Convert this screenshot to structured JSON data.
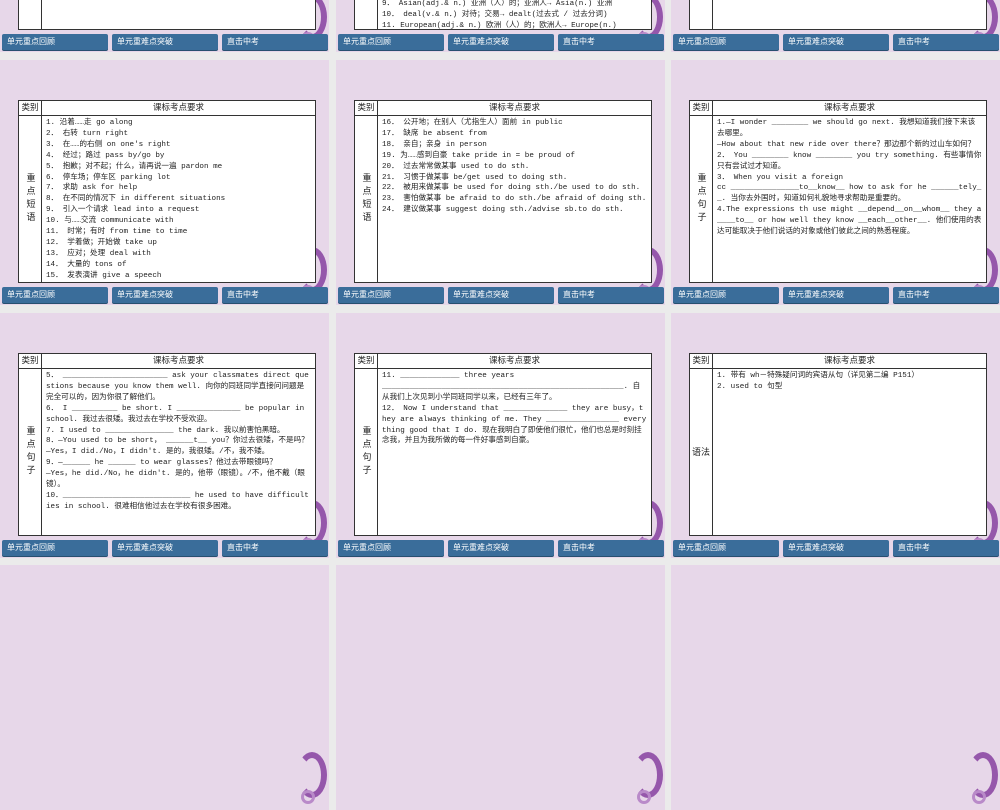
{
  "nav": [
    "单元重点回顾",
    "单元重难点突破",
    "直击中考"
  ],
  "table_header": {
    "category": "类别",
    "requirement": "课标考点要求"
  },
  "colors": {
    "slide_bg": "#e7d7e9",
    "nav_bg": "#3a6d9a",
    "decor": "#8d4aa5"
  },
  "slides": [
    {
      "category": "",
      "lines": []
    },
    {
      "category": "",
      "align": "bottom",
      "lines": [
        "9． Asian(adj.& n．) 亚洲（人）的；亚洲人→ Asia(n.) 亚洲",
        "10． deal(v.& n．) 对待；交易→ dealt(过去式 / 过去分词)",
        "11. European(adj.& n．) 欧洲（人）的；欧洲人→ Europe(n.)"
      ]
    },
    {
      "category": "",
      "lines": []
    },
    {
      "category": "重点短语",
      "lines": [
        "1. 沿着……走 go along",
        "2． 右转 turn right",
        "3． 在……的右侧 on one's right",
        "4． 经过；路过 pass by/go by",
        "5． 抱歉；对不起；什么，请再说一遍 pardon me",
        "6． 停车场；停车区 parking lot",
        "7． 求助 ask for help",
        "8． 在不同的情况下 in different situations",
        "9． 引入一个请求 lead into a request",
        "10. 与……交流 communicate with",
        "11． 时常；有时 from time to time",
        "12． 学着做；开始做 take up",
        "13． 应对；处理 deal with",
        "14． 大量的 tons of",
        "15． 发表演讲 give a speech"
      ]
    },
    {
      "category": "重点短语",
      "lines": [
        "16． 公开地；在别人（尤指生人）面前 in public",
        "17． 缺席 be absent from",
        "18． 亲自；亲身 in person",
        "19. 为……感到自豪 take pride in = be proud of",
        "20． 过去常常做某事 used to do sth.",
        "21． 习惯于做某事 be/get used to doing sth.",
        "22． 被用来做某事 be used for doing sth./be used to do sth.",
        "23． 害怕做某事 be afraid to do sth./be afraid of doing sth.",
        "24． 建议做某事 suggest doing sth./advise sb.to do sth."
      ]
    },
    {
      "category": "重点句子",
      "lines": [
        "1.—I wonder ________ we should go next. 我想知道我们接下来该去哪里。",
        "—How about that new ride over there？那边那个新的过山车如何？",
        "2． You ________ know ________ you try something. 有些事情你只有尝试过才知道。",
        "3． When you visit a foreign",
        "cc   _______________to__know__ how to ask for he  ______tely__. 当你去外国时，知道如何礼貌地寻求帮助是重要的。",
        "4.The expressions th  use might __depend__on__whom__ they a     ____to__ or how well they know __each__other__. 他们使用的表达可能取决于他们说话的对象或他们彼此之间的熟悉程度。"
      ]
    },
    {
      "category": "重点句子",
      "lines": [
        "5． _______________________ ask your classmates direct questions because you know them well. 向你的同班同学直接问问题是完全可以的，因为你很了解他们。",
        "6． I __________ be short. I ______________ be popular in school. 我过去很矮。我过去在学校不受欢迎。",
        "7. I used to _______________ the dark. 我以前害怕黑暗。",
        "8．—You used to be short， ______t__ you？你过去很矮，不是吗？",
        "—Yes，I did./No，I didn't. 是的，我很矮。/不，我不矮。",
        "9．—______ he ______ to wear glasses？他过去带眼镜吗？",
        "—Yes，he did./No，he didn't. 是的，他带（眼镜）。/不，他不戴（眼镜）。",
        "10．____________________________ he used to have difficulties in school. 很难相信他过去在学校有很多困难。"
      ]
    },
    {
      "category": "重点句子",
      "lines": [
        "11. _____________ three years",
        "_____________________________________________________. 自从我们上次见到小学同班同学以来，已经有三年了。",
        "12． Now I understand that ______________ they are busy，they are always thinking of me. They ________________ everything good that I do. 现在我明白了即使他们很忙，他们也总是时刻挂念我，并且为我所做的每一件好事感到自豪。"
      ]
    },
    {
      "category": "语法",
      "horizontal": true,
      "lines": [
        "1. 带有 wh－特殊疑问词的宾语从句（详见第二编 P151）",
        "2. used to 句型"
      ]
    },
    {
      "category": "",
      "empty": true,
      "lines": []
    },
    {
      "category": "",
      "empty": true,
      "lines": []
    },
    {
      "category": "",
      "empty": true,
      "lines": []
    }
  ]
}
